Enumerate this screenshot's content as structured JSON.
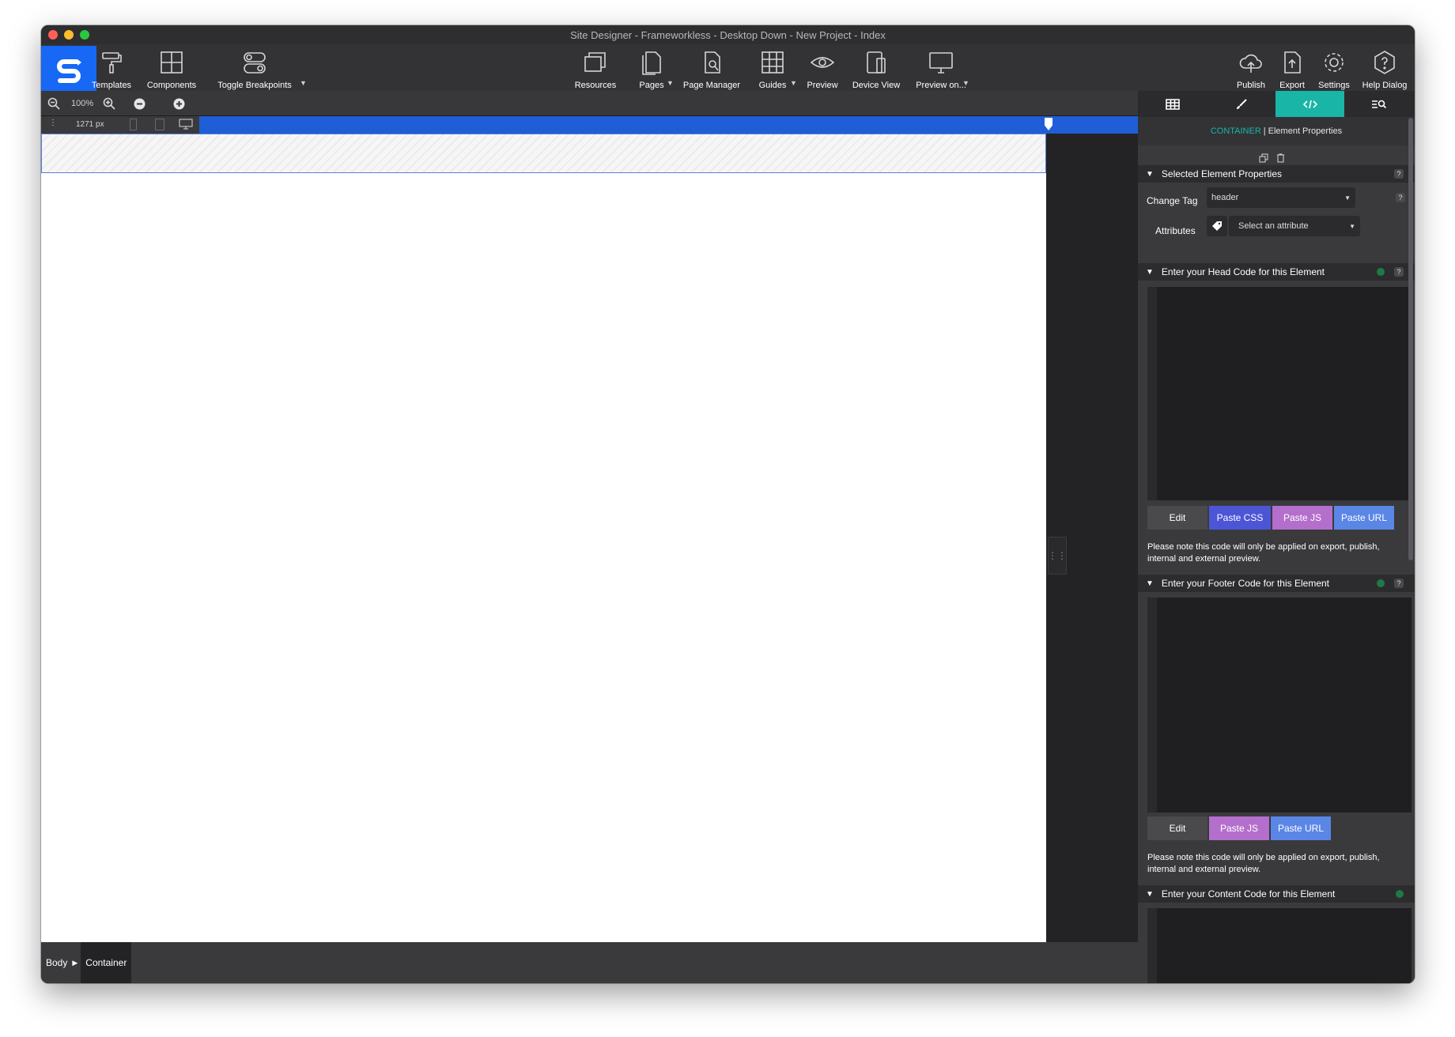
{
  "window": {
    "title": "Site Designer - Frameworkless - Desktop Down - New Project - Index"
  },
  "toolbar": {
    "templates": "Templates",
    "components": "Components",
    "toggle_breakpoints": "Toggle Breakpoints",
    "resources": "Resources",
    "pages": "Pages",
    "page_manager": "Page Manager",
    "guides": "Guides",
    "preview": "Preview",
    "device_view": "Device View",
    "preview_on": "Preview on...",
    "publish": "Publish",
    "export": "Export",
    "settings": "Settings",
    "help_dialog": "Help Dialog"
  },
  "zoom": {
    "level": "100%"
  },
  "ruler": {
    "width_value": "1271 px"
  },
  "breadcrumb": {
    "items": [
      "Body",
      "Container"
    ]
  },
  "panel": {
    "header_element": "CONTAINER",
    "header_separator": "|",
    "header_title": "Element Properties",
    "sections": {
      "selected": "Selected Element Properties",
      "head_code": "Enter your Head Code for this Element",
      "footer_code": "Enter your Footer Code for this Element",
      "content_code": "Enter your Content Code for this Element"
    },
    "change_tag_label": "Change Tag",
    "change_tag_value": "header",
    "attributes_label": "Attributes",
    "attributes_placeholder": "Select an attribute",
    "help": "?",
    "head_buttons": {
      "edit": "Edit",
      "paste_css": "Paste CSS",
      "paste_js": "Paste JS",
      "paste_url": "Paste URL"
    },
    "footer_buttons": {
      "edit": "Edit",
      "paste_js": "Paste JS",
      "paste_url": "Paste URL"
    },
    "note": "Please note this code will only be applied on export, publish, internal and external preview."
  },
  "colors": {
    "accent": "#19b5a6",
    "brand": "#1668f5",
    "paste_css": "#4b55d6",
    "paste_js": "#b46fcc",
    "paste_url": "#5a86e6"
  }
}
